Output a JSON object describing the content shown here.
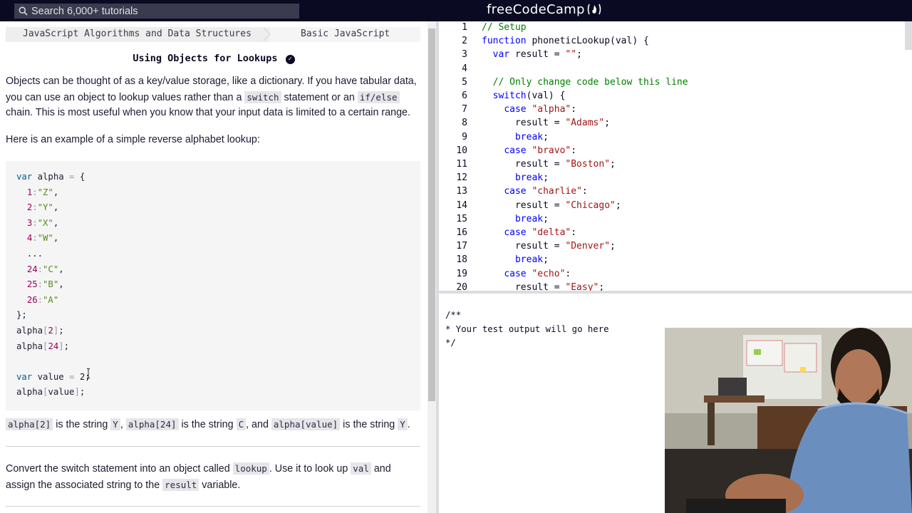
{
  "nav": {
    "search_placeholder": "Search 6,000+ tutorials",
    "brand": "freeCodeCamp",
    "brand_flame": "(🔥)"
  },
  "breadcrumb": {
    "section": "JavaScript Algorithms and Data Structures",
    "subsection": "Basic JavaScript"
  },
  "challenge": {
    "title": "Using Objects for Lookups",
    "para1_a": "Objects can be thought of as a key/value storage, like a dictionary. If you have tabular data, you can use an object to lookup values rather than a ",
    "para1_code1": "switch",
    "para1_b": " statement or an ",
    "para1_code2": "if/else",
    "para1_c": " chain. This is most useful when you know that your input data is limited to a certain range.",
    "para2": "Here is an example of a simple reverse alphabet lookup:",
    "example_code": [
      "var alpha = {",
      "  1:\"Z\",",
      "  2:\"Y\",",
      "  3:\"X\",",
      "  4:\"W\",",
      "  ...",
      "  24:\"C\",",
      "  25:\"B\",",
      "  26:\"A\"",
      "};",
      "alpha[2];",
      "alpha[24];",
      "",
      "var value = 2;",
      "alpha[value];"
    ],
    "para3_code1": "alpha[2]",
    "para3_a": " is the string ",
    "para3_code2": "Y",
    "para3_b": ", ",
    "para3_code3": "alpha[24]",
    "para3_c": " is the string ",
    "para3_code4": "C",
    "para3_d": ", and ",
    "para3_code5": "alpha[value]",
    "para3_e": " is the string ",
    "para3_code6": "Y",
    "para3_f": ".",
    "para4_a": "Convert the switch statement into an object called ",
    "para4_code1": "lookup",
    "para4_b": ". Use it to look up ",
    "para4_code2": "val",
    "para4_c": " and assign the associated string to the ",
    "para4_code3": "result",
    "para4_d": " variable."
  },
  "editor": {
    "lines": [
      {
        "n": "1",
        "text": "// Setup"
      },
      {
        "n": "2",
        "text": "function phoneticLookup(val) {"
      },
      {
        "n": "3",
        "text": "  var result = \"\";"
      },
      {
        "n": "4",
        "text": ""
      },
      {
        "n": "5",
        "text": "  // Only change code below this line"
      },
      {
        "n": "6",
        "text": "  switch(val) {"
      },
      {
        "n": "7",
        "text": "    case \"alpha\":"
      },
      {
        "n": "8",
        "text": "      result = \"Adams\";"
      },
      {
        "n": "9",
        "text": "      break;"
      },
      {
        "n": "10",
        "text": "    case \"bravo\":"
      },
      {
        "n": "11",
        "text": "      result = \"Boston\";"
      },
      {
        "n": "12",
        "text": "      break;"
      },
      {
        "n": "13",
        "text": "    case \"charlie\":"
      },
      {
        "n": "14",
        "text": "      result = \"Chicago\";"
      },
      {
        "n": "15",
        "text": "      break;"
      },
      {
        "n": "16",
        "text": "    case \"delta\":"
      },
      {
        "n": "17",
        "text": "      result = \"Denver\";"
      },
      {
        "n": "18",
        "text": "      break;"
      },
      {
        "n": "19",
        "text": "    case \"echo\":"
      },
      {
        "n": "20",
        "text": "      result = \"Easy\";"
      }
    ]
  },
  "output": {
    "text": "/**\n* Your test output will go here\n*/"
  },
  "colors": {
    "nav_bg": "#0a0a23",
    "search_bg": "#3b3b4f",
    "comment": "#008000",
    "keyword": "#0000ff",
    "string": "#a31515"
  },
  "icons": {
    "search": "search-icon",
    "check": "check-circle-icon",
    "flame": "flame-icon"
  }
}
